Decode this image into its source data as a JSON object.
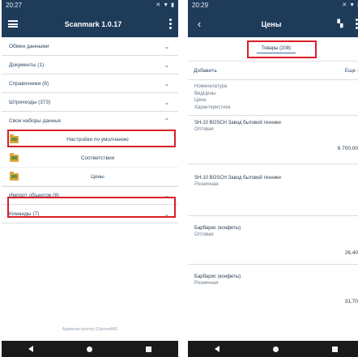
{
  "left": {
    "status": {
      "time": "20:27"
    },
    "appbar": {
      "title": "Scanmark 1.0.17"
    },
    "menu": {
      "items": [
        {
          "label": "Обмен данными"
        },
        {
          "label": "Документы (1)"
        },
        {
          "label": "Справочники (8)"
        },
        {
          "label": "Штрихкоды (373)"
        },
        {
          "label": "Свои наборы данных"
        }
      ],
      "subitems": [
        {
          "label": "Настройки по умолчанию"
        },
        {
          "label": "Соответствия"
        },
        {
          "label": "Цены"
        }
      ],
      "after": [
        {
          "label": "Импорт объектов (8)"
        },
        {
          "label": "Команды (7)"
        }
      ]
    },
    "footer": {
      "user": "Администратор (ОрловАВ)"
    }
  },
  "right": {
    "status": {
      "time": "20:29"
    },
    "appbar": {
      "title": "Цены"
    },
    "tab": {
      "label": "Товары (208)"
    },
    "actions": {
      "add": "Добавить",
      "more": "Еще"
    },
    "header_fields": [
      "Номенклатура",
      "ВидЦены",
      "Цена",
      "Характеристика"
    ],
    "items": [
      {
        "name": "SH-10 BOSCH Завод бытовой техники",
        "price_type": "Оптовая",
        "price": "6 700,00"
      },
      {
        "name": "SH-10 BOSCH Завод бытовой техники",
        "price_type": "Розничная",
        "price": ""
      },
      {
        "name": "Барбарис (конфеты)",
        "price_type": "Оптовая",
        "price": "26,40"
      },
      {
        "name": "Барбарис (конфеты)",
        "price_type": "Розничная",
        "price": "31,70"
      }
    ]
  },
  "colors": {
    "appbar": "#1f3b5a",
    "highlight": "#d91f26",
    "navbar": "#1a1a1a"
  },
  "icons": [
    "hamburger-icon",
    "kebab-menu-icon",
    "back-arrow-icon",
    "sort-icon",
    "chevron-down-icon",
    "chevron-up-icon",
    "folder-icon",
    "nav-back-icon",
    "nav-home-icon",
    "nav-recent-icon"
  ]
}
